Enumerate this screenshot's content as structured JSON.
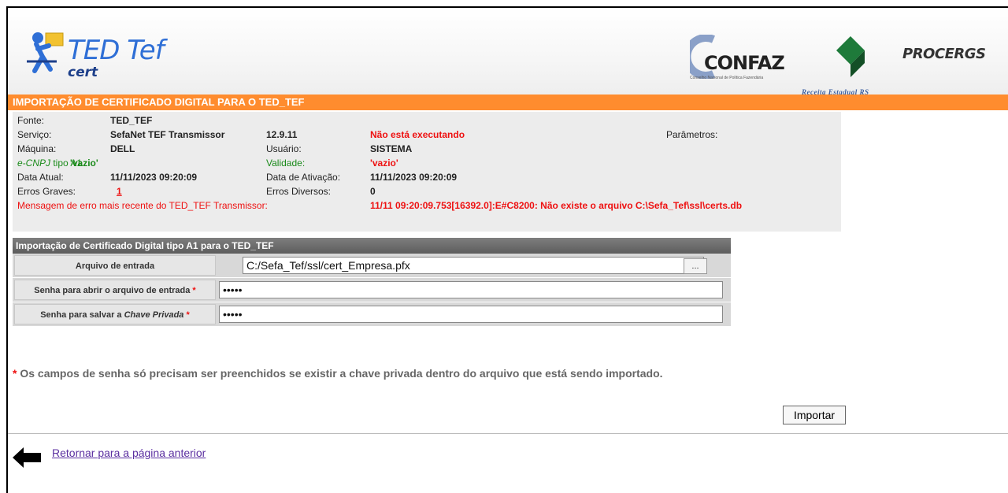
{
  "header": {
    "logo_title": "TED Tef",
    "logo_sub": "cert",
    "confaz": "CONFAZ",
    "confaz_sub": "Conselho Nacional de Política Fazendária",
    "receita": "Receita Estadual RS",
    "procergs": "PROCERGS"
  },
  "banner": "IMPORTAÇÃO DE CERTIFICADO DIGITAL PARA O TED_TEF",
  "info": {
    "fonte_label": "Fonte:",
    "fonte_value": "TED_TEF",
    "servico_label": "Serviço:",
    "servico_value": "SefaNet TEF Transmissor",
    "servico_version": "12.9.11",
    "servico_status": "Não está executando",
    "parametros_label": "Parâmetros:",
    "maquina_label": "Máquina:",
    "maquina_value": "DELL",
    "usuario_label": "Usuário:",
    "usuario_value": "SISTEMA",
    "ecnpj_label_prefix": "e-CNPJ",
    "ecnpj_label_suffix": " tipo A1",
    "ecnpj_value": "'vazio'",
    "validade_label": "Validade:",
    "validade_value": "'vazio'",
    "data_atual_label": "Data Atual:",
    "data_atual_value": "11/11/2023 09:20:09",
    "data_ativacao_label": "Data de Ativação:",
    "data_ativacao_value": "11/11/2023 09:20:09",
    "erros_graves_label": "Erros Graves:",
    "erros_graves_value": "1",
    "erros_diversos_label": "Erros Diversos:",
    "erros_diversos_value": "0",
    "msg_erro_label": "Mensagem de erro mais recente do TED_TEF Transmissor:",
    "msg_erro_value": "11/11 09:20:09.753[16392.0]:E#C8200: Não existe o arquivo C:\\Sefa_Tef\\ssl\\certs.db"
  },
  "import_form": {
    "title": "Importação de Certificado Digital tipo A1 para o TED_TEF",
    "arquivo_label": "Arquivo de entrada",
    "arquivo_value": "C:/Sefa_Tef/ssl/cert_Empresa.pfx",
    "browse_label": "...",
    "senha_abrir_label": "Senha para abrir o arquivo de entrada",
    "senha_abrir_value": "•••••",
    "senha_salvar_label_prefix": "Senha para salvar a ",
    "senha_salvar_label_em": "Chave Privada",
    "senha_salvar_value": "•••••",
    "required_mark": "*"
  },
  "note": {
    "mark": "*",
    "text": " Os campos de senha só precisam ser preenchidos se existir a chave privada dentro do arquivo que está sendo importado."
  },
  "importar_label": "Importar",
  "back_link": "Retornar para a página anterior"
}
